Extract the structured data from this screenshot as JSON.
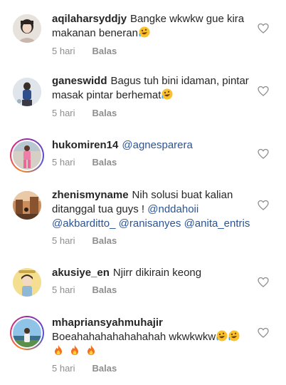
{
  "comments": [
    {
      "username": "aqilaharsyddjy",
      "text": "Bangke wkwkw gue kira makanan beneran",
      "emoji_after": "rolling-laughing-emoji",
      "time": "5 hari",
      "reply": "Balas"
    },
    {
      "username": "ganeswidd",
      "text": "Bagus tuh bini idaman, pintar masak pintar berhemat",
      "emoji_after": "rolling-laughing-emoji",
      "time": "5 hari",
      "reply": "Balas"
    },
    {
      "username": "hukomiren14",
      "mention1": "@agnesparera",
      "time": "5 hari",
      "reply": "Balas"
    },
    {
      "username": "zhenismyname",
      "text": "Nih solusi buat kalian ditanggal tua guys ! ",
      "mention1": "@nddahoii",
      "mention2": "@akbarditto_",
      "mention3": "@ranisanyes",
      "mention4": "@anita_entris",
      "time": "5 hari",
      "reply": "Balas"
    },
    {
      "username": "akusiye_en",
      "text": "Njirr dikirain keong",
      "time": "5 hari",
      "reply": "Balas"
    },
    {
      "username": "mhapriansyahmuhajir",
      "text": "Boeahahahahahahahah wkwkwkw",
      "emoji_after": "rolling-laughing-emoji x2",
      "emoji_line2": "fire-emoji x3",
      "time": "5 hari",
      "reply": "Balas"
    }
  ],
  "colors": {
    "text": "#262626",
    "meta": "#8e8e8e",
    "mention": "#2a5496"
  }
}
